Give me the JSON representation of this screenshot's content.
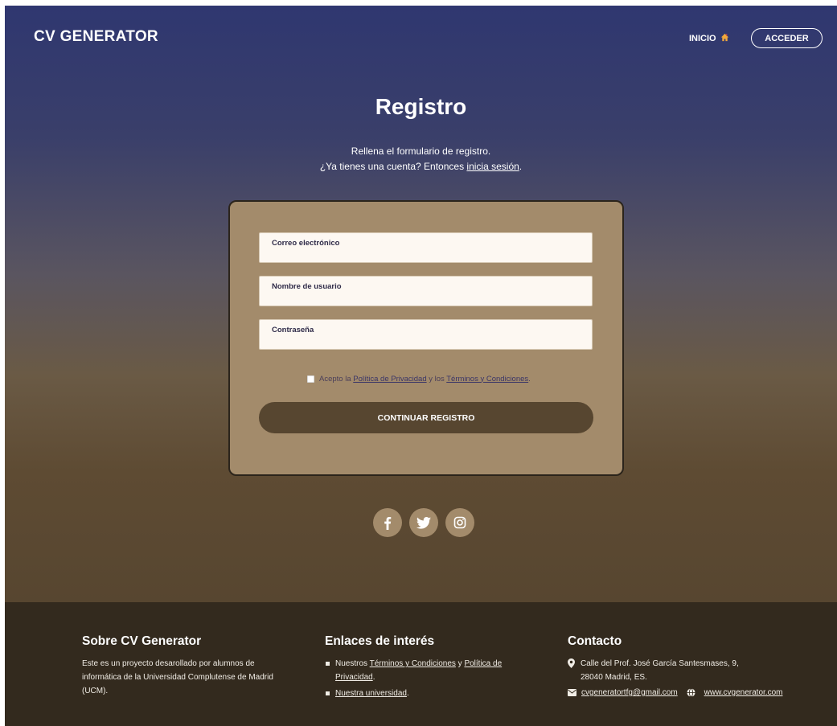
{
  "header": {
    "brand": "CV GENERATOR",
    "nav_home": "INICIO",
    "nav_login": "ACCEDER"
  },
  "main": {
    "title": "Registro",
    "subtitle_line1": "Rellena el formulario de registro.",
    "subtitle_line2_prefix": "¿Ya tienes una cuenta? Entonces ",
    "subtitle_link": "inicia sesión",
    "subtitle_line2_suffix": "."
  },
  "form": {
    "email_label": "Correo electrónico",
    "username_label": "Nombre de usuario",
    "password_label": "Contraseña",
    "terms_prefix": "Acepto la ",
    "terms_privacy": "Política de Privacidad",
    "terms_mid": " y los ",
    "terms_conditions": "Términos y Condiciones",
    "terms_suffix": ".",
    "continue_label": "CONTINUAR REGISTRO"
  },
  "social": [
    "facebook-icon",
    "twitter-icon",
    "instagram-icon"
  ],
  "footer": {
    "about_title": "Sobre CV Generator",
    "about_text": "Este es un proyecto desarollado por alumnos de informática de la Universidad Complutense de Madrid (UCM).",
    "links_title": "Enlaces de interés",
    "link1_prefix": "Nuestros ",
    "link1_terms": "Términos y Condiciones",
    "link1_mid": " y ",
    "link1_privacy": "Política de Privacidad",
    "link1_suffix": ".",
    "link2": "Nuestra universidad",
    "link2_suffix": ".",
    "contact_title": "Contacto",
    "address_line1": "Calle del Prof. José García Santesmases, 9,",
    "address_line2": "28040 Madrid, ES.",
    "email": "cvgeneratortfg@gmail.com",
    "website": "www.cvgenerator.com"
  },
  "colors": {
    "hero_top": "#2f3770",
    "hero_bottom": "#574630",
    "card": "#a38b6b",
    "button": "#574630",
    "footer": "#332a1e"
  }
}
